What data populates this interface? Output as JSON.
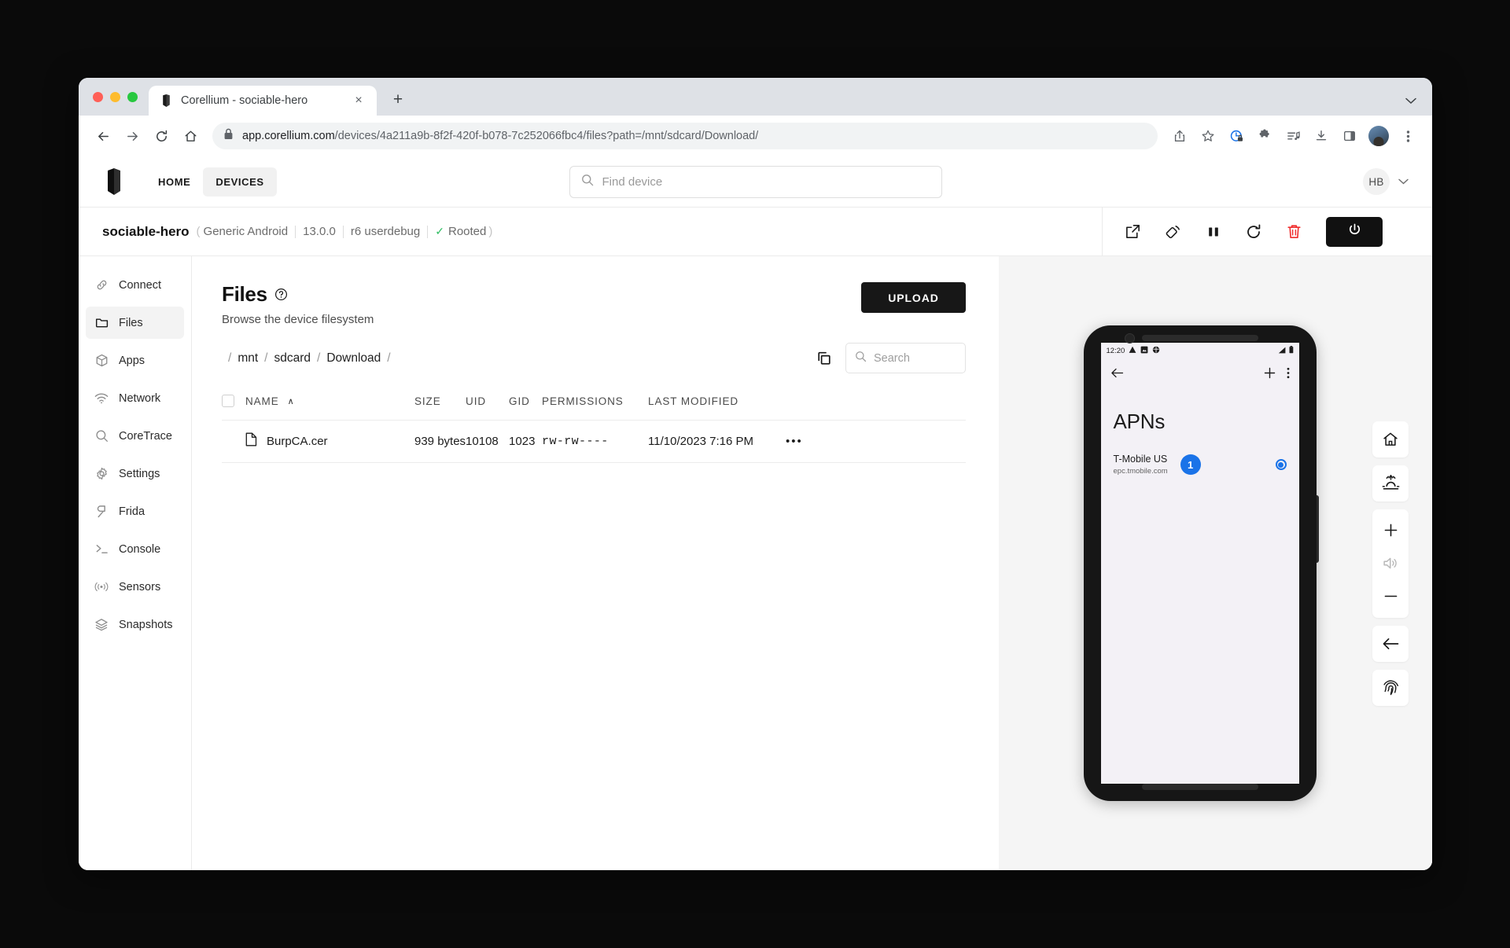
{
  "browser": {
    "tab": {
      "title": "Corellium - sociable-hero",
      "favicon": "corellium-logo-icon",
      "close": "×"
    },
    "new_tab": "+",
    "tab_list_caret": "chevron-down-icon",
    "url_prefix": "app.corellium.com",
    "url_rest": "/devices/4a211a9b-8f2f-420f-b078-7c252066fbc4/files?path=/mnt/sdcard/Download/",
    "nav": {
      "back": "←",
      "forward": "→",
      "reload": "reload-icon",
      "home": "home-icon"
    },
    "actions": [
      "share-icon",
      "bookmark-star-icon",
      "privacy-shield-icon",
      "extensions-puzzle-icon",
      "media-list-icon",
      "download-icon",
      "side-panel-icon",
      "profile-avatar",
      "more-menu-icon"
    ]
  },
  "app_nav": {
    "logo": "corellium-logo-icon",
    "items": [
      {
        "label": "HOME",
        "active": false
      },
      {
        "label": "DEVICES",
        "active": true
      }
    ],
    "search_placeholder": "Find device",
    "profile_initials": "HB",
    "profile_caret": "chevron-down-icon"
  },
  "device_header": {
    "name": "sociable-hero",
    "open_paren": "(",
    "close_paren": ")",
    "model": "Generic Android",
    "os_version": "13.0.0",
    "build": "r6 userdebug",
    "root_check": "✓",
    "root_label": "Rooted",
    "actions": [
      {
        "name": "open-external-icon"
      },
      {
        "name": "rotate-device-icon"
      },
      {
        "name": "pause-icon"
      },
      {
        "name": "restart-icon"
      },
      {
        "name": "delete-icon"
      }
    ],
    "power_label": "power-icon"
  },
  "sidebar": {
    "items": [
      {
        "label": "Connect",
        "icon": "link-icon",
        "active": false
      },
      {
        "label": "Files",
        "icon": "folder-icon",
        "active": true
      },
      {
        "label": "Apps",
        "icon": "cube-icon",
        "active": false
      },
      {
        "label": "Network",
        "icon": "wifi-icon",
        "active": false
      },
      {
        "label": "CoreTrace",
        "icon": "search-icon",
        "active": false
      },
      {
        "label": "Settings",
        "icon": "gear-icon",
        "active": false
      },
      {
        "label": "Frida",
        "icon": "frida-icon",
        "active": false
      },
      {
        "label": "Console",
        "icon": "terminal-icon",
        "active": false
      },
      {
        "label": "Sensors",
        "icon": "broadcast-icon",
        "active": false
      },
      {
        "label": "Snapshots",
        "icon": "layers-icon",
        "active": false
      }
    ]
  },
  "files": {
    "title": "Files",
    "help_icon": "help-circle-icon",
    "subtitle": "Browse the device filesystem",
    "upload_label": "UPLOAD",
    "breadcrumbs": [
      "mnt",
      "sdcard",
      "Download"
    ],
    "breadcrumb_sep": "/",
    "copy_path_icon": "copy-icon",
    "search_placeholder": "Search",
    "columns": [
      "NAME",
      "SIZE",
      "UID",
      "GID",
      "PERMISSIONS",
      "LAST MODIFIED"
    ],
    "sort_column": "NAME",
    "sort_caret": "∧",
    "rows": [
      {
        "icon": "file-icon",
        "name": "BurpCA.cer",
        "size": "939 bytes",
        "uid": "10108",
        "gid": "1023",
        "permissions": "rw-rw----",
        "last_modified": "11/10/2023 7:16 PM",
        "menu": "•••"
      }
    ]
  },
  "phone": {
    "status_time": "12:20",
    "status_icons": [
      "warning-triangle-icon",
      "image-icon",
      "bug-icon"
    ],
    "status_right_icons": [
      "signal-icon",
      "battery-icon"
    ],
    "app_bar": {
      "back": "←",
      "add": "+",
      "overflow": "⋮"
    },
    "screen_title": "APNs",
    "apn": {
      "name": "T-Mobile US",
      "subtitle": "epc.tmobile.com",
      "step_number": "1",
      "selected": true
    }
  },
  "hardware_rail": {
    "buttons": [
      {
        "name": "home-icon"
      },
      {
        "name": "brightness-icon"
      },
      {
        "name": "volume-up-icon"
      },
      {
        "name": "speaker-icon"
      },
      {
        "name": "volume-down-icon"
      },
      {
        "name": "back-icon"
      },
      {
        "name": "fingerprint-icon"
      }
    ]
  },
  "colors": {
    "accent_blue": "#1a73e8",
    "rooted_green": "#2fbd62",
    "danger_red": "#f02d2d",
    "button_black": "#171717"
  }
}
